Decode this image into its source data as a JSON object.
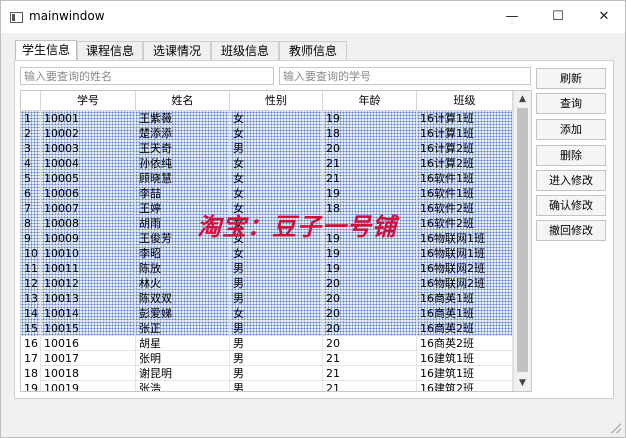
{
  "window": {
    "title": "mainwindow",
    "minimize": "—",
    "maximize": "☐",
    "close": "✕"
  },
  "tabs": [
    {
      "label": "学生信息"
    },
    {
      "label": "课程信息"
    },
    {
      "label": "选课情况"
    },
    {
      "label": "班级信息"
    },
    {
      "label": "教师信息"
    }
  ],
  "search": {
    "name_placeholder": "输入要查询的姓名",
    "id_placeholder": "输入要查询的学号"
  },
  "buttons": {
    "refresh": "刷新",
    "query": "查询",
    "add": "添加",
    "delete": "删除",
    "edit": "进入修改",
    "confirm": "确认修改",
    "revert": "撤回修改"
  },
  "table": {
    "headers": [
      "学号",
      "姓名",
      "性别",
      "年龄",
      "班级"
    ],
    "rows": [
      [
        "1",
        "10001",
        "王紫薇",
        "女",
        "19",
        "16计算1班"
      ],
      [
        "2",
        "10002",
        "楚添添",
        "女",
        "18",
        "16计算1班"
      ],
      [
        "3",
        "10003",
        "王天奇",
        "男",
        "20",
        "16计算2班"
      ],
      [
        "4",
        "10004",
        "孙依纯",
        "女",
        "21",
        "16计算2班"
      ],
      [
        "5",
        "10005",
        "顾晓慧",
        "女",
        "21",
        "16软件1班"
      ],
      [
        "6",
        "10006",
        "李喆",
        "女",
        "19",
        "16软件1班"
      ],
      [
        "7",
        "10007",
        "王婷",
        "女",
        "18",
        "16软件2班"
      ],
      [
        "8",
        "10008",
        "胡雨",
        "女",
        "",
        "16软件2班"
      ],
      [
        "9",
        "10009",
        "王俊芳",
        "女",
        "19",
        "16物联网1班"
      ],
      [
        "10",
        "10010",
        "李昭",
        "女",
        "19",
        "16物联网1班"
      ],
      [
        "11",
        "10011",
        "陈放",
        "男",
        "19",
        "16物联网2班"
      ],
      [
        "12",
        "10012",
        "林火",
        "男",
        "20",
        "16物联网2班"
      ],
      [
        "13",
        "10013",
        "陈双双",
        "男",
        "20",
        "16商英1班"
      ],
      [
        "14",
        "10014",
        "彭爱娣",
        "女",
        "20",
        "16商英1班"
      ],
      [
        "15",
        "10015",
        "张正",
        "男",
        "20",
        "16商英2班"
      ],
      [
        "16",
        "10016",
        "胡星",
        "男",
        "20",
        "16商英2班"
      ],
      [
        "17",
        "10017",
        "张明",
        "男",
        "21",
        "16建筑1班"
      ],
      [
        "18",
        "10018",
        "谢昆明",
        "男",
        "21",
        "16建筑1班"
      ],
      [
        "19",
        "10019",
        "张浩",
        "男",
        "21",
        "16建筑2班"
      ]
    ],
    "selected_rows": 15
  },
  "watermark": "淘宝：豆子一号铺",
  "colors": {
    "selection_dots": "#5d80c8",
    "watermark": "#d0103a"
  }
}
